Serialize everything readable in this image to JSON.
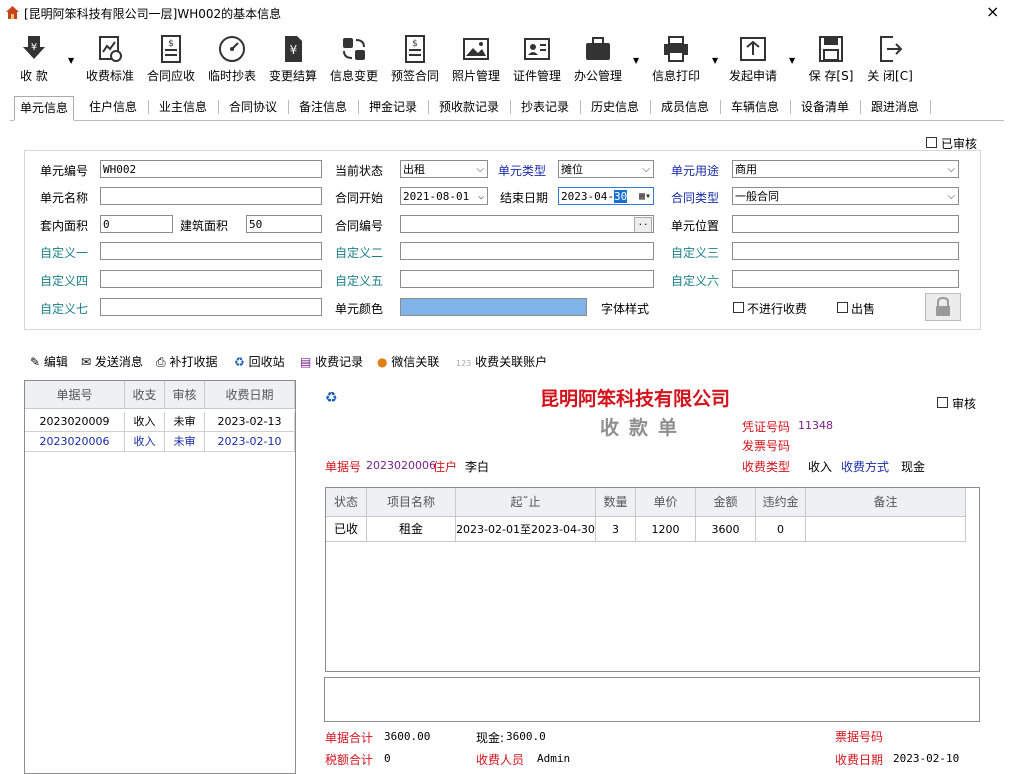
{
  "window": {
    "title": "[昆明阿笨科技有限公司一层]WH002的基本信息",
    "close": "×"
  },
  "toolbar": [
    {
      "label": "收 款",
      "icon": "yen-download-icon"
    },
    {
      "label": "收费标准",
      "icon": "settings-chart-icon"
    },
    {
      "label": "合同应收",
      "icon": "invoice-icon"
    },
    {
      "label": "临时抄表",
      "icon": "meter-icon"
    },
    {
      "label": "变更结算",
      "icon": "yen-document-icon"
    },
    {
      "label": "信息变更",
      "icon": "swap-icon"
    },
    {
      "label": "预签合同",
      "icon": "contract-icon"
    },
    {
      "label": "照片管理",
      "icon": "photo-icon"
    },
    {
      "label": "证件管理",
      "icon": "id-card-icon"
    },
    {
      "label": "办公管理",
      "icon": "briefcase-icon"
    },
    {
      "label": "信息打印",
      "icon": "printer-icon"
    },
    {
      "label": "发起申请",
      "icon": "upload-icon"
    },
    {
      "label": "保 存[S]",
      "icon": "save-icon"
    },
    {
      "label": "关 闭[C]",
      "icon": "exit-icon"
    }
  ],
  "tabs": [
    "单元信息",
    "住户信息",
    "业主信息",
    "合同协议",
    "备注信息",
    "押金记录",
    "预收款记录",
    "抄表记录",
    "历史信息",
    "成员信息",
    "车辆信息",
    "设备清单",
    "跟进消息"
  ],
  "form": {
    "audited_label": "已审核",
    "unit_no_label": "单元编号",
    "unit_no": "WH002",
    "status_label": "当前状态",
    "status": "出租",
    "unit_type_label": "单元类型",
    "unit_type": "摊位",
    "unit_use_label": "单元用途",
    "unit_use": "商用",
    "unit_name_label": "单元名称",
    "unit_name": "",
    "contract_start_label": "合同开始",
    "contract_start": "2021-08-01",
    "end_date_label": "结束日期",
    "end_date_prefix": "2023-04-",
    "end_date_day": "30",
    "contract_type_label": "合同类型",
    "contract_type": "一般合同",
    "inner_area_label": "套内面积",
    "inner_area": "0",
    "build_area_label": "建筑面积",
    "build_area": "50",
    "contract_no_label": "合同编号",
    "contract_no": "",
    "ellipsis": "..",
    "unit_position_label": "单元位置",
    "unit_position": "",
    "custom1_label": "自定义一",
    "custom2_label": "自定义二",
    "custom3_label": "自定义三",
    "custom4_label": "自定义四",
    "custom5_label": "自定义五",
    "custom6_label": "自定义六",
    "custom7_label": "自定义七",
    "unit_color_label": "单元颜色",
    "unit_color": "#80b3e6",
    "font_style_label": "字体样式",
    "no_charge_label": "不进行收费",
    "sold_label": "出售"
  },
  "actions": [
    {
      "label": "编辑",
      "icon": "pencil-icon"
    },
    {
      "label": "发送消息",
      "icon": "envelope-icon"
    },
    {
      "label": "补打收据",
      "icon": "printer-icon"
    },
    {
      "label": "回收站",
      "icon": "recycle-icon"
    },
    {
      "label": "收费记录",
      "icon": "records-icon"
    },
    {
      "label": "微信关联",
      "icon": "wechat-user-icon"
    },
    {
      "label": "收费关联账户",
      "icon": "account-link-icon",
      "badge": "123"
    }
  ],
  "bill_list": {
    "columns": [
      "单据号",
      "收支",
      "审核",
      "收费日期"
    ],
    "rows": [
      {
        "no": "2023020009",
        "type": "收入",
        "audit": "未审",
        "date": "2023-02-13"
      },
      {
        "no": "2023020006",
        "type": "收入",
        "audit": "未审",
        "date": "2023-02-10"
      }
    ]
  },
  "receipt": {
    "company": "昆明阿笨科技有限公司",
    "title": "收款单",
    "audit_label": "审核",
    "voucher_label": "凭证号码",
    "voucher_no": "11348",
    "invoice_label": "发票号码",
    "invoice_no": "",
    "bill_no_label": "单据号",
    "bill_no": "2023020006",
    "resident_label": "住户",
    "resident": "李白",
    "charge_type_label": "收费类型",
    "charge_type": "收入",
    "pay_method_label": "收费方式",
    "pay_method": "现金",
    "columns": [
      "状态",
      "项目名称",
      "起˜止",
      "数量",
      "单价",
      "金额",
      "违约金",
      "备注"
    ],
    "items": [
      {
        "status": "已收",
        "name": "租金",
        "period": "2023-02-01至2023-04-30",
        "qty": "3",
        "price": "1200",
        "amount": "3600",
        "penalty": "0",
        "remark": ""
      }
    ],
    "total_label": "单据合计",
    "total": "3600.00",
    "cash_label": "现金:",
    "cash": "3600.0",
    "ticket_label": "票据号码",
    "ticket_no": "",
    "tax_label": "税额合计",
    "tax": "0",
    "collector_label": "收费人员",
    "collector": "Admin",
    "date_label": "收费日期",
    "date": "2023-02-10"
  }
}
